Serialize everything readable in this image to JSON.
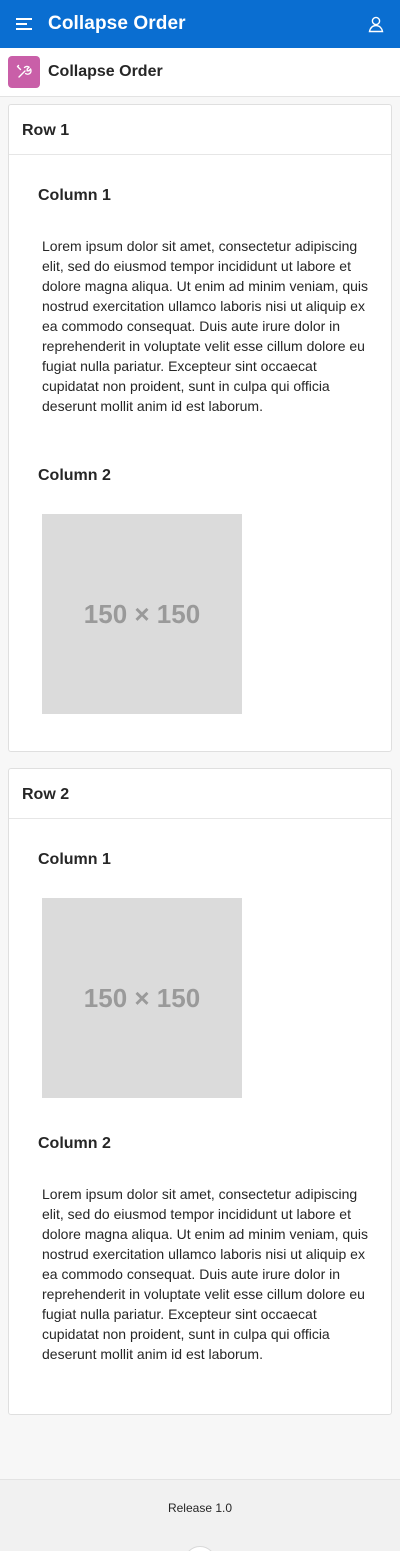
{
  "header": {
    "title": "Collapse Order",
    "menu_icon": "hamburger-menu-icon",
    "user_icon": "user-icon",
    "color": "#0a6ed1"
  },
  "page": {
    "title": "Collapse Order",
    "icon": "wrench-icon",
    "icon_color": "#c95fa8"
  },
  "regions": [
    {
      "title": "Row 1",
      "columns": [
        {
          "title": "Column 1",
          "text": "Lorem ipsum dolor sit amet, consectetur adipiscing elit, sed do eiusmod tempor incididunt ut labore et dolore magna aliqua. Ut enim ad minim veniam, quis nostrud exercitation ullamco laboris nisi ut aliquip ex ea commodo consequat. Duis aute irure dolor in reprehenderit in voluptate velit esse cillum dolore eu fugiat nulla pariatur. Excepteur sint occaecat cupidatat non proident, sunt in culpa qui officia deserunt mollit anim id est laborum."
        },
        {
          "title": "Column 2",
          "image_label": "150 × 150"
        }
      ]
    },
    {
      "title": "Row 2",
      "columns": [
        {
          "title": "Column 1",
          "image_label": "150 × 150"
        },
        {
          "title": "Column 2",
          "text": "Lorem ipsum dolor sit amet, consectetur adipiscing elit, sed do eiusmod tempor incididunt ut labore et dolore magna aliqua. Ut enim ad minim veniam, quis nostrud exercitation ullamco laboris nisi ut aliquip ex ea commodo consequat. Duis aute irure dolor in reprehenderit in voluptate velit esse cillum dolore eu fugiat nulla pariatur. Excepteur sint occaecat cupidatat non proident, sunt in culpa qui officia deserunt mollit anim id est laborum."
        }
      ]
    }
  ],
  "footer": {
    "release": "Release 1.0"
  }
}
